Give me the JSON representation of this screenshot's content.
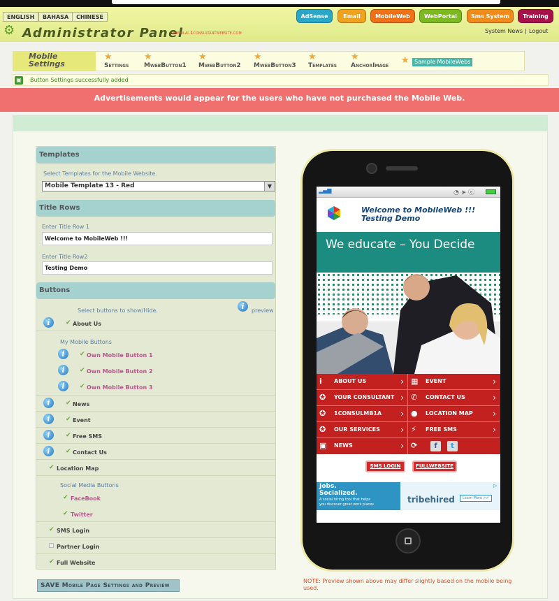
{
  "languages": [
    "ENGLISH",
    "BAHASA",
    "CHINESE"
  ],
  "top_nav": [
    {
      "label": "AdSense",
      "color": "#2aa6c9"
    },
    {
      "label": "Email",
      "color": "#f0a21f"
    },
    {
      "label": "MobileWeb",
      "color": "#f07018"
    },
    {
      "label": "WebPortal",
      "color": "#7cb81f"
    },
    {
      "label": "Sms System",
      "color": "#f08a1a"
    },
    {
      "label": "Training",
      "color": "#a8124a"
    }
  ],
  "admin": {
    "title": "Administrator Panel",
    "user": "ayienilai.1consultantwebsite.com",
    "links": [
      "System News",
      "Logout"
    ],
    "sep": "|"
  },
  "tabs": {
    "section": [
      "Mobile",
      "Settings"
    ],
    "items": [
      "Settings",
      "MwebButton1",
      "MwebButton2",
      "MwebButton3",
      "Templates",
      "AnchorImage",
      "Sample MobileWebs"
    ]
  },
  "message": "Button Settings successfully added",
  "ad_notice": "Advertisements would appear for the users who have not purchased the Mobile Web.",
  "form": {
    "templates_heading": "Templates",
    "templates_label": "Select Templates for the Mobile Website.",
    "template_value": "Mobile Template 13 - Red",
    "title_heading": "Title Rows",
    "title1_label": "Enter Title Row 1",
    "title1_value": "Welcome to MobileWeb !!!",
    "title2_label": "Enter Title Row2",
    "title2_value": "Testing Demo",
    "buttons_heading": "Buttons",
    "buttons_label": "Select buttons to show/Hide.",
    "preview_label": "preview",
    "my_buttons_label": "My Mobile Buttons",
    "social_label": "Social Media Buttons",
    "rows": [
      {
        "label": "About Us",
        "checked": true
      },
      {
        "label": "Own Mobile Button 1",
        "checked": true
      },
      {
        "label": "Own Mobile Button 2",
        "checked": true
      },
      {
        "label": "Own Mobile Button 3",
        "checked": true
      },
      {
        "label": "News",
        "checked": true
      },
      {
        "label": "Event",
        "checked": true
      },
      {
        "label": "Free SMS",
        "checked": true
      },
      {
        "label": "Contact Us",
        "checked": true
      },
      {
        "label": "Location Map",
        "checked": true
      },
      {
        "label": "FaceBook",
        "checked": true
      },
      {
        "label": "Twitter",
        "checked": true
      },
      {
        "label": "SMS Login",
        "checked": true
      },
      {
        "label": "Partner Login",
        "checked": false
      },
      {
        "label": "Full Website",
        "checked": true
      }
    ],
    "save_label": "SAVE Mobile Page Settings and Preview",
    "note": "NOTE:  Preview shown above may differ slightly based on the mobile being used."
  },
  "phone": {
    "title1": "Welcome to MobileWeb !!!",
    "title2": "Testing Demo",
    "slogan": "We educate – You Decide",
    "menu": [
      [
        "ABOUT US",
        "EVENT"
      ],
      [
        "YOUR CONSULTANT",
        "CONTACT US"
      ],
      [
        "1CONSULMB1A",
        "LOCATION MAP"
      ],
      [
        "OUR SERVICES",
        "FREE SMS"
      ],
      [
        "NEWS",
        ""
      ]
    ],
    "social": [
      "f",
      "t"
    ],
    "buttons": [
      "SMS LOGIN",
      "FULLWEBSITE"
    ],
    "ad": {
      "line1": "Jobs.",
      "line2": "Socialized.",
      "line3": "A social hiring tool that helps",
      "line4": "you discover great work places",
      "brand": "tribehired",
      "cta": "Learn More >>"
    }
  }
}
